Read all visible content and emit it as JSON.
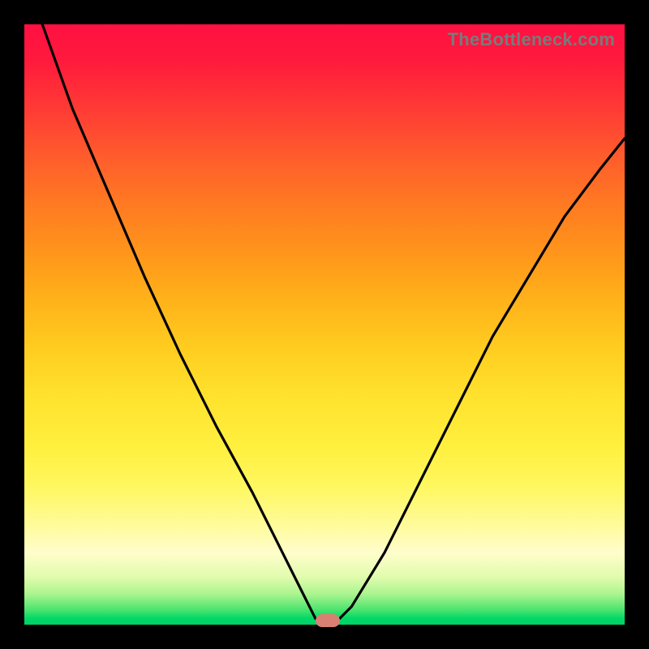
{
  "attribution": "TheBottleneck.com",
  "colors": {
    "frame": "#000000",
    "marker": "#d98073",
    "curve": "#000000",
    "gradient_stops": [
      {
        "offset": 0.0,
        "color": "#ff1042"
      },
      {
        "offset": 0.06,
        "color": "#ff1a3c"
      },
      {
        "offset": 0.14,
        "color": "#ff3a35"
      },
      {
        "offset": 0.22,
        "color": "#ff5c2c"
      },
      {
        "offset": 0.3,
        "color": "#ff7a22"
      },
      {
        "offset": 0.38,
        "color": "#ff951b"
      },
      {
        "offset": 0.46,
        "color": "#ffb21a"
      },
      {
        "offset": 0.54,
        "color": "#ffcd1f"
      },
      {
        "offset": 0.62,
        "color": "#ffe22e"
      },
      {
        "offset": 0.7,
        "color": "#ffef3d"
      },
      {
        "offset": 0.77,
        "color": "#fff760"
      },
      {
        "offset": 0.83,
        "color": "#fffb96"
      },
      {
        "offset": 0.88,
        "color": "#fffdcc"
      },
      {
        "offset": 0.92,
        "color": "#e2fcae"
      },
      {
        "offset": 0.95,
        "color": "#a8f48e"
      },
      {
        "offset": 0.975,
        "color": "#4ce46e"
      },
      {
        "offset": 0.99,
        "color": "#00d868"
      },
      {
        "offset": 1.0,
        "color": "#00d264"
      }
    ]
  },
  "marker": {
    "x_pct": 0.505,
    "y_pct": 0.993
  },
  "chart_data": {
    "type": "line",
    "title": "",
    "xlabel": "",
    "ylabel": "",
    "xlim": [
      0,
      100
    ],
    "ylim": [
      0,
      100
    ],
    "series": [
      {
        "name": "bottleneck-curve",
        "x": [
          3,
          8,
          14,
          20,
          26,
          32,
          38,
          43,
          46.5,
          48.5,
          52.5,
          54.5,
          60,
          66,
          72,
          78,
          84,
          90,
          96,
          100
        ],
        "y": [
          100,
          86,
          72,
          58,
          45,
          33,
          22,
          12,
          5,
          1,
          1,
          3,
          12,
          24,
          36,
          48,
          58,
          68,
          76,
          81
        ]
      }
    ],
    "notes": "V-shaped curve on a vertical red-to-green heat gradient; minimum at x≈50 touching y≈0. Values estimated from pixel positions; no axes or tick labels shown."
  }
}
